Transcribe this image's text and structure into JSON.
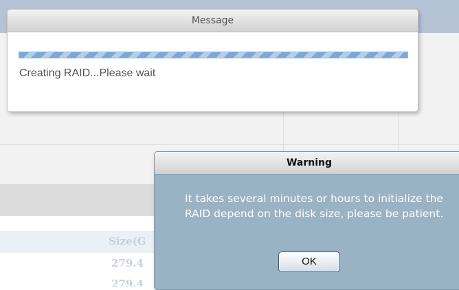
{
  "message_dialog": {
    "title": "Message",
    "progress_text": "Creating RAID...Please wait"
  },
  "warning_dialog": {
    "title": "Warning",
    "text": "It takes several minutes or hours to initialize the RAID depend on the disk size, please be patient.",
    "ok_label": "OK"
  },
  "background_table": {
    "header_fragment": "Size(G",
    "values": [
      "279.4",
      "279.4"
    ]
  },
  "colors": {
    "warning_body": "#99b3c4",
    "progress": "#7aa8d8",
    "page_accent": "#b5c3d6"
  }
}
